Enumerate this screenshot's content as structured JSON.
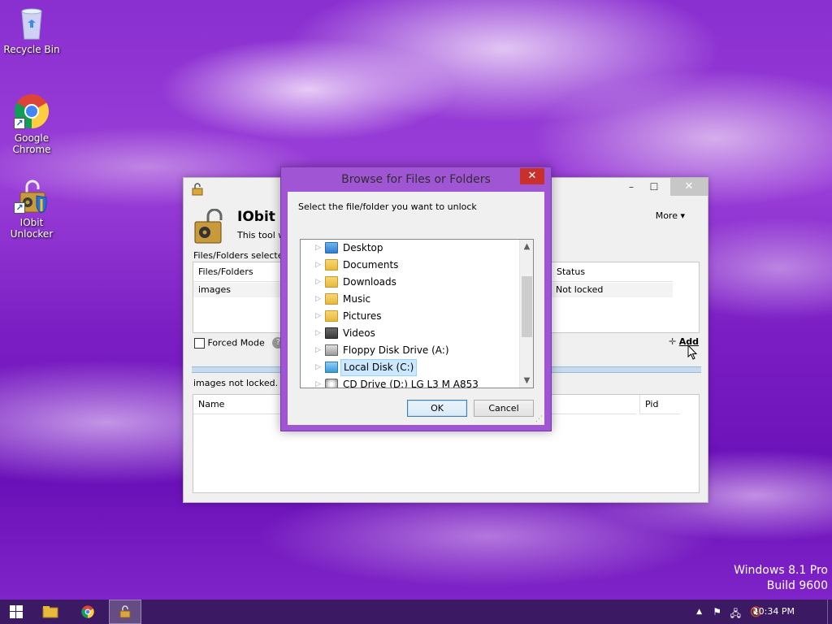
{
  "desktop": {
    "icons": [
      {
        "label_line1": "Recycle Bin",
        "label_line2": ""
      },
      {
        "label_line1": "Google",
        "label_line2": "Chrome"
      },
      {
        "label_line1": "IObit",
        "label_line2": "Unlocker"
      }
    ],
    "watermark": {
      "line1": "Windows 8.1 Pro",
      "line2": "Build 9600"
    }
  },
  "main_window": {
    "app_title": "IObit U",
    "app_desc": "This tool wi",
    "more_label": "More ▾",
    "files_selected_label": "Files/Folders selected",
    "table": {
      "col_files": "Files/Folders",
      "col_status": "Status",
      "rows": [
        {
          "file": "images",
          "status": "Not locked"
        }
      ]
    },
    "forced_mode_label": "Forced Mode",
    "add_label": "Add",
    "status_message": "images not locked.",
    "process_table": {
      "col_name": "Name",
      "col_pid": "Pid"
    }
  },
  "dialog": {
    "title": "Browse for Files or Folders",
    "prompt": "Select the file/folder you want to unlock",
    "tree": [
      {
        "label": "Desktop",
        "icon": "desktop-folder-icon",
        "selected": false
      },
      {
        "label": "Documents",
        "icon": "documents-folder-icon",
        "selected": false
      },
      {
        "label": "Downloads",
        "icon": "downloads-folder-icon",
        "selected": false
      },
      {
        "label": "Music",
        "icon": "music-folder-icon",
        "selected": false
      },
      {
        "label": "Pictures",
        "icon": "pictures-folder-icon",
        "selected": false
      },
      {
        "label": "Videos",
        "icon": "videos-folder-icon",
        "selected": false
      },
      {
        "label": "Floppy Disk Drive (A:)",
        "icon": "floppy-drive-icon",
        "selected": false
      },
      {
        "label": "Local Disk (C:)",
        "icon": "local-disk-icon",
        "selected": true
      },
      {
        "label": "CD Drive (D:) LG L3 M A853",
        "icon": "cd-drive-icon",
        "selected": false
      }
    ],
    "ok_label": "OK",
    "cancel_label": "Cancel"
  },
  "taskbar": {
    "clock": "10:34 PM"
  }
}
